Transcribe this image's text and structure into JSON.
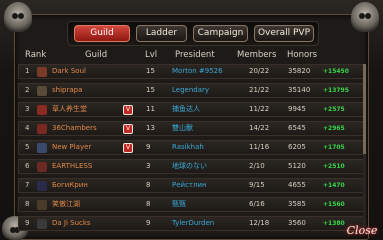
{
  "tabs": [
    {
      "label": "Guild",
      "active": true
    },
    {
      "label": "Ladder",
      "active": false
    },
    {
      "label": "Campaign",
      "active": false
    },
    {
      "label": "Overall PVP",
      "active": false
    }
  ],
  "columns": {
    "rank": "Rank",
    "guild": "Guild",
    "lvl": "Lvl",
    "president": "President",
    "members": "Members",
    "honors": "Honors"
  },
  "rows": [
    {
      "rank": "1",
      "guild": "Dark Soul",
      "badge": "",
      "lvl": "15",
      "president": "Morton #9526",
      "members": "20/22",
      "honors": "35820",
      "gain": "+15450",
      "emblem": "#7a3a2a"
    },
    {
      "rank": "2",
      "guild": "shiprapa",
      "badge": "",
      "lvl": "15",
      "president": "Legendary",
      "members": "21/22",
      "honors": "35140",
      "gain": "+13795",
      "emblem": "#5a4a3a"
    },
    {
      "rank": "3",
      "guild": "草人养生堂",
      "badge": "V",
      "lvl": "11",
      "president": "捕鱼达人",
      "members": "11/22",
      "honors": "9945",
      "gain": "+2575",
      "emblem": "#8a2a22"
    },
    {
      "rank": "4",
      "guild": "36Chambers",
      "badge": "V",
      "lvl": "13",
      "president": "雙山獸",
      "members": "14/22",
      "honors": "6545",
      "gain": "+2965",
      "emblem": "#7a2822"
    },
    {
      "rank": "5",
      "guild": "New Player",
      "badge": "V",
      "lvl": "9",
      "president": "Rasikhah",
      "members": "11/16",
      "honors": "6205",
      "gain": "+1705",
      "emblem": "#3a4a6a"
    },
    {
      "rank": "6",
      "guild": "EARTHLESS",
      "badge": "",
      "lvl": "3",
      "president": "地球のない",
      "members": "2/10",
      "honors": "5120",
      "gain": "+2510",
      "emblem": "#6a2a22"
    },
    {
      "rank": "7",
      "guild": "БогиКрин",
      "badge": "",
      "lvl": "8",
      "president": "Рейстлин",
      "members": "9/15",
      "honors": "4655",
      "gain": "+1470",
      "emblem": "#2a2a4a"
    },
    {
      "rank": "8",
      "guild": "笑傲江湖",
      "badge": "",
      "lvl": "8",
      "president": "甄甄",
      "members": "6/16",
      "honors": "3585",
      "gain": "+1560",
      "emblem": "#4a3a2a"
    },
    {
      "rank": "9",
      "guild": "Da Ji Sucks",
      "badge": "",
      "lvl": "9",
      "president": "TylerDurden",
      "members": "12/18",
      "honors": "3560",
      "gain": "+1380",
      "emblem": "#3a3a3a"
    }
  ],
  "close_label": "Close"
}
